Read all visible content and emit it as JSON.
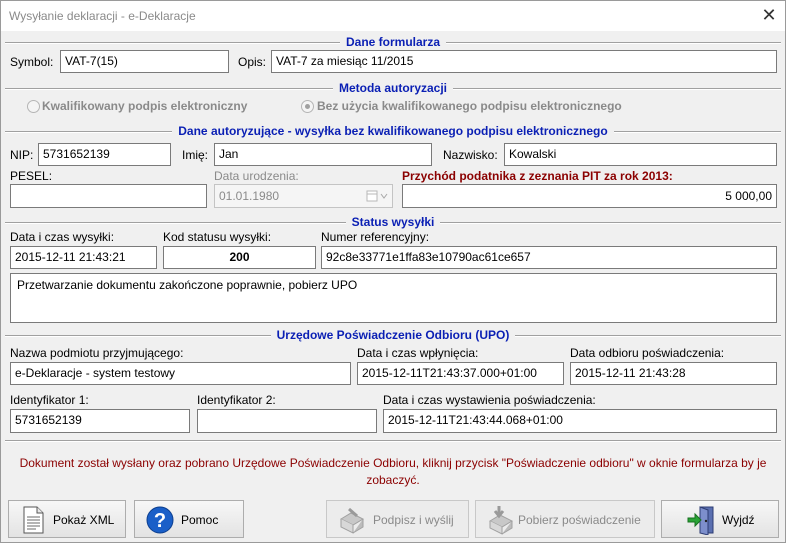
{
  "window": {
    "title": "Wysyłanie deklaracji - e-Deklaracje",
    "close_glyph": "✕"
  },
  "sections": {
    "form": "Dane formularza",
    "auth_method": "Metoda autoryzacji",
    "auth_data": "Dane autoryzujące - wysyłka bez kwalifikowanego podpisu elektronicznego",
    "status": "Status wysyłki",
    "upo": "Urzędowe Poświadczenie Odbioru (UPO)"
  },
  "form": {
    "symbol_label": "Symbol:",
    "symbol_value": "VAT-7(15)",
    "opis_label": "Opis:",
    "opis_value": "VAT-7 za miesiąc 11/2015"
  },
  "auth_method": {
    "option1": "Kwalifikowany podpis elektroniczny",
    "option2": "Bez użycia kwalifikowanego podpisu elektronicznego",
    "selected": "option2"
  },
  "auth_data": {
    "nip_label": "NIP:",
    "nip_value": "5731652139",
    "imie_label": "Imię:",
    "imie_value": "Jan",
    "nazwisko_label": "Nazwisko:",
    "nazwisko_value": "Kowalski",
    "pesel_label": "PESEL:",
    "pesel_value": "",
    "birth_label": "Data urodzenia:",
    "birth_value": "01.01.1980",
    "income_label": "Przychód podatnika z zeznania PIT za rok 2013:",
    "income_value": "5 000,00"
  },
  "status": {
    "datetime_label": "Data i czas wysyłki:",
    "datetime_value": "2015-12-11 21:43:21",
    "code_label": "Kod statusu wysyłki:",
    "code_value": "200",
    "ref_label": "Numer referencyjny:",
    "ref_value": "92c8e33771e1ffa83e10790ac61ce657",
    "message": "Przetwarzanie dokumentu zakończone poprawnie, pobierz UPO"
  },
  "upo": {
    "recipient_label": "Nazwa podmiotu przyjmującego:",
    "recipient_value": "e-Deklaracje - system testowy",
    "arrival_label": "Data i czas wpłynięcia:",
    "arrival_value": "2015-12-11T21:43:37.000+01:00",
    "receipt_label": "Data odbioru poświadczenia:",
    "receipt_value": "2015-12-11 21:43:28",
    "id1_label": "Identyfikator 1:",
    "id1_value": "5731652139",
    "id2_label": "Identyfikator 2:",
    "id2_value": "",
    "issued_label": "Data i czas wystawienia poświadczenia:",
    "issued_value": "2015-12-11T21:43:44.068+01:00"
  },
  "footer_message": "Dokument został wysłany oraz pobrano Urzędowe Poświadczenie Odbioru, kliknij przycisk \"Poświadczenie odbioru\" w oknie formularza by je zobaczyć.",
  "buttons": {
    "xml": "Pokaż XML",
    "help": "Pomoc",
    "sign_send": "Podpisz i wyślij",
    "get_receipt": "Pobierz poświadczenie",
    "exit": "Wyjdź"
  },
  "icons": {
    "xml": "document-icon",
    "help": "help-icon",
    "sign_send": "sign-send-icon",
    "get_receipt": "download-receipt-icon",
    "exit": "exit-door-icon",
    "calendar": "calendar-dropdown-icon"
  },
  "colors": {
    "section_title": "#0a1fb4",
    "warning_text": "#8b0000",
    "disabled_text": "#8a8a8a"
  }
}
